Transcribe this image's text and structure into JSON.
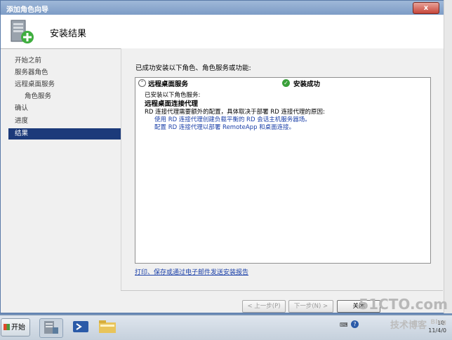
{
  "window": {
    "title": "添加角色向导",
    "close_label": "x"
  },
  "header": {
    "title": "安装结果",
    "icon": "server-add-icon"
  },
  "steps": [
    {
      "label": "开始之前"
    },
    {
      "label": "服务器角色"
    },
    {
      "label": "远程桌面服务"
    },
    {
      "label": "角色服务"
    },
    {
      "label": "确认"
    },
    {
      "label": "进度"
    },
    {
      "label": "结果"
    }
  ],
  "content": {
    "description": "已成功安装以下角色、角色服务或功能:",
    "result": {
      "role": "远程桌面服务",
      "status": "安装成功",
      "line1": "已安装以下角色服务:",
      "service": "远程桌面连接代理",
      "note": "RD 连接代理需要额外的配置，具体取决于部署 RD 连接代理的原因:",
      "link1": "使用 RD 连接代理创建负载平衡的 RD 会话主机服务器场。",
      "link2": "配置 RD 连接代理以部署 RemoteApp 和桌面连接。"
    },
    "report_link": "打印、保存或通过电子邮件发送安装报告"
  },
  "buttons": {
    "prev": "< 上一步(P)",
    "next": "下一步(N) >",
    "close": "关闭"
  },
  "taskbar": {
    "start": "开始",
    "apps": [
      "server-manager-icon",
      "powershell-icon",
      "explorer-icon"
    ],
    "clock": "10:",
    "date": "11/4/0"
  },
  "watermark": {
    "main": "51CTO.com",
    "sub": "技术博客",
    "tag": "Blog"
  },
  "colors": {
    "active_step": "#1c3a7a",
    "link": "#1a3fa8",
    "success": "#3aa03a"
  }
}
